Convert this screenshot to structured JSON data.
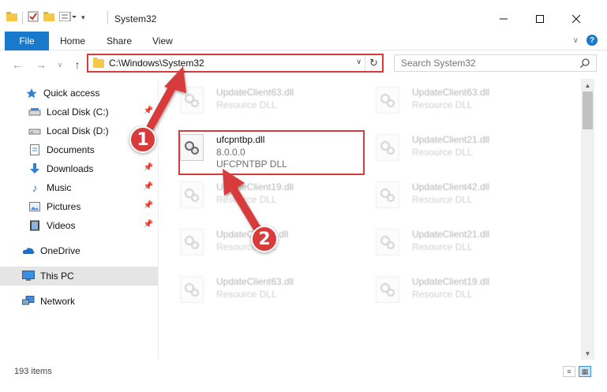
{
  "window": {
    "title": "System32"
  },
  "ribbon": {
    "tabs": [
      "File",
      "Home",
      "Share",
      "View"
    ],
    "help": "?"
  },
  "address": {
    "path": "C:\\Windows\\System32"
  },
  "search": {
    "placeholder": "Search System32"
  },
  "sidebar": {
    "items": [
      {
        "label": "Quick access",
        "icon": "star-icon"
      },
      {
        "label": "Local Disk (C:)",
        "icon": "drive-icon",
        "pinned": true
      },
      {
        "label": "Local Disk (D:)",
        "icon": "drive-icon"
      },
      {
        "label": "Documents",
        "icon": "documents-icon",
        "pinned": true
      },
      {
        "label": "Downloads",
        "icon": "download-icon",
        "pinned": true
      },
      {
        "label": "Music",
        "icon": "music-icon",
        "pinned": true
      },
      {
        "label": "Pictures",
        "icon": "pictures-icon",
        "pinned": true
      },
      {
        "label": "Videos",
        "icon": "videos-icon",
        "pinned": true
      },
      {
        "label": "OneDrive",
        "icon": "cloud-icon"
      },
      {
        "label": "This PC",
        "icon": "computer-icon",
        "selected": true
      },
      {
        "label": "Network",
        "icon": "network-icon"
      }
    ]
  },
  "files": {
    "highlighted": {
      "name": "ufcpntbp.dll",
      "version": "8.0.0.0",
      "description": "UFCPNTBP DLL"
    },
    "left_column": [
      {
        "name": "UpdateClient63.dll",
        "type": "Resource DLL"
      },
      {
        "name": "UpdateClient19.dll",
        "type": "Resource DLL"
      },
      {
        "name": "UpdateClient5.dll",
        "type": "Resource DLL"
      },
      {
        "name": "UpdateClient63.dll",
        "type": "Resource DLL"
      }
    ],
    "right_column": [
      {
        "name": "UpdateClient63.dll",
        "type": "Resource DLL"
      },
      {
        "name": "UpdateClient21.dll",
        "type": "Resource DLL"
      },
      {
        "name": "UpdateClient42.dll",
        "type": "Resource DLL"
      },
      {
        "name": "UpdateClient21.dll",
        "type": "Resource DLL"
      },
      {
        "name": "UpdateClient19.dll",
        "type": "Resource DLL"
      }
    ]
  },
  "status": {
    "item_count": "193 items"
  },
  "annotations": {
    "step1": "1",
    "step2": "2",
    "color": "#d83b3b"
  }
}
